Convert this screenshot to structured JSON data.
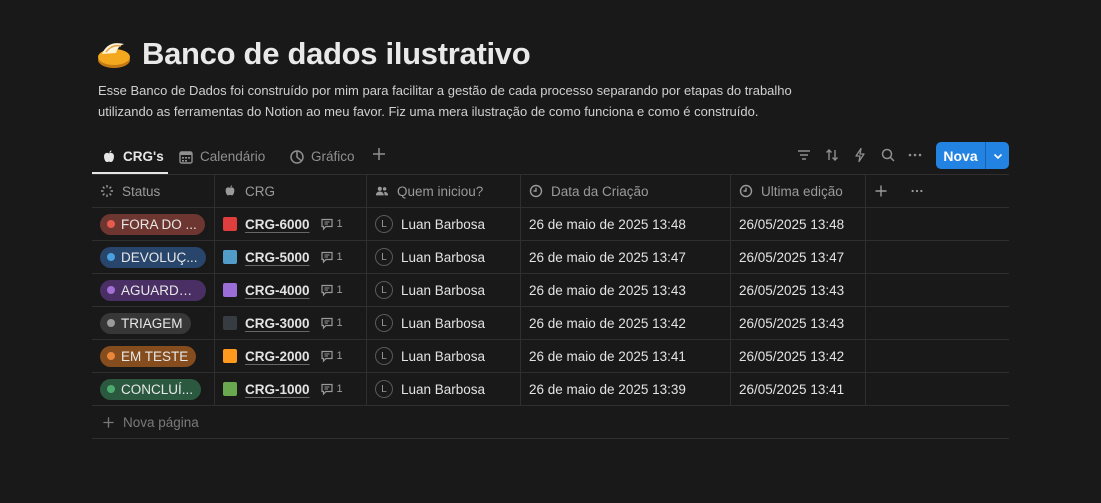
{
  "page": {
    "icon": "orange-disc-emoji-icon",
    "title": "Banco de dados ilustrativo",
    "description_line1": "Esse Banco de Dados foi construído por mim para facilitar a gestão de cada processo separando por etapas do trabalho",
    "description_line2": "utilizando as ferramentas do Notion ao meu favor. Fiz uma mera ilustração de como funciona e como é construído."
  },
  "tabs": [
    {
      "label": "CRG's",
      "icon": "apple-icon",
      "active": true
    },
    {
      "label": "Calendário",
      "icon": "calendar-icon",
      "active": false
    },
    {
      "label": "Gráfico",
      "icon": "pie-chart-icon",
      "active": false
    }
  ],
  "toolbar": {
    "icons": [
      "filter-icon",
      "sort-icon",
      "lightning-icon",
      "search-icon",
      "more-icon"
    ],
    "new_label": "Nova"
  },
  "columns": [
    {
      "label": "Status",
      "icon": "status-icon"
    },
    {
      "label": "CRG",
      "icon": "apple-icon"
    },
    {
      "label": "Quem iniciou?",
      "icon": "people-icon"
    },
    {
      "label": "Data da Criação",
      "icon": "clock-icon"
    },
    {
      "label": "Ultima edição",
      "icon": "clock-icon"
    }
  ],
  "rows": [
    {
      "status": "FORA DO PRAZO",
      "status_display": "FORA DO ...",
      "status_bg": "#6e3630",
      "status_dot": "#e55b4d",
      "color": "#e03e3e",
      "crg": "CRG-6000",
      "comments": "1",
      "avatar": "L",
      "person": "Luan Barbosa",
      "created": "26 de maio de 2025 13:48",
      "edited": "26/05/2025 13:48"
    },
    {
      "status": "DEVOLUÇÃO",
      "status_display": "DEVOLUÇ...",
      "status_bg": "#28456c",
      "status_dot": "#4a9fe0",
      "color": "#529cca",
      "crg": "CRG-5000",
      "comments": "1",
      "avatar": "L",
      "person": "Luan Barbosa",
      "created": "26 de maio de 2025 13:47",
      "edited": "26/05/2025 13:47"
    },
    {
      "status": "AGUARDANDO",
      "status_display": "AGUARDA...",
      "status_bg": "#492f64",
      "status_dot": "#a46fd6",
      "color": "#9a6dd7",
      "crg": "CRG-4000",
      "comments": "1",
      "avatar": "L",
      "person": "Luan Barbosa",
      "created": "26 de maio de 2025 13:43",
      "edited": "26/05/2025 13:43"
    },
    {
      "status": "TRIAGEM",
      "status_display": "TRIAGEM",
      "status_bg": "#373737",
      "status_dot": "#9b9b9b",
      "color": "#373c43",
      "crg": "CRG-3000",
      "comments": "1",
      "avatar": "L",
      "person": "Luan Barbosa",
      "created": "26 de maio de 2025 13:42",
      "edited": "26/05/2025 13:43"
    },
    {
      "status": "EM TESTE",
      "status_display": "EM TESTE",
      "status_bg": "#854c1d",
      "status_dot": "#e8873a",
      "color": "#ff9a1f",
      "crg": "CRG-2000",
      "comments": "1",
      "avatar": "L",
      "person": "Luan Barbosa",
      "created": "26 de maio de 2025 13:41",
      "edited": "26/05/2025 13:42"
    },
    {
      "status": "CONCLUÍDO",
      "status_display": "CONCLUÍ...",
      "status_bg": "#2b593f",
      "status_dot": "#4dab6f",
      "color": "#6aa84f",
      "crg": "CRG-1000",
      "comments": "1",
      "avatar": "L",
      "person": "Luan Barbosa",
      "created": "26 de maio de 2025 13:39",
      "edited": "26/05/2025 13:41"
    }
  ],
  "new_page_label": "Nova página"
}
